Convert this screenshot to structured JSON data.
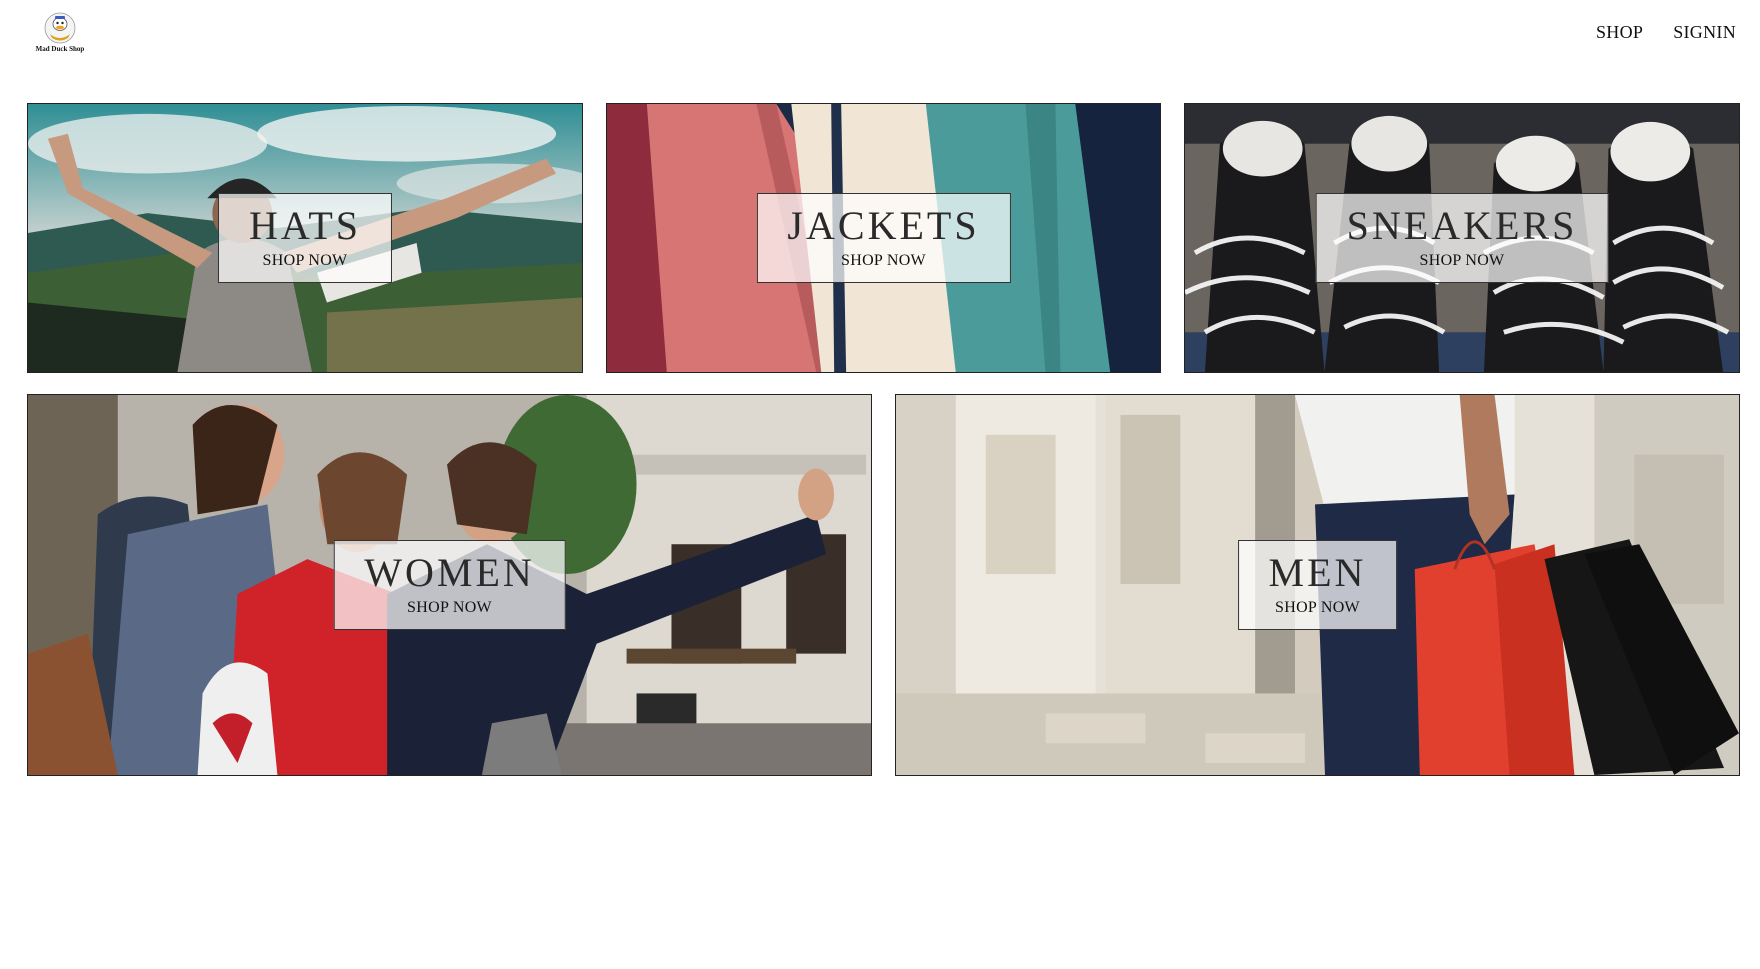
{
  "header": {
    "logo_alt": "Mad Duck Shop",
    "logo_text": "Mad Duck Shop",
    "logo_icon": "duck-logo-icon",
    "nav": [
      {
        "label": "SHOP"
      },
      {
        "label": "SIGNIN"
      }
    ]
  },
  "categories": [
    {
      "title": "HATS",
      "cta": "SHOP NOW"
    },
    {
      "title": "JACKETS",
      "cta": "SHOP NOW"
    },
    {
      "title": "SNEAKERS",
      "cta": "SHOP NOW"
    },
    {
      "title": "WOMEN",
      "cta": "SHOP NOW"
    },
    {
      "title": "MEN",
      "cta": "SHOP NOW"
    }
  ],
  "colors": {
    "text": "#111111",
    "border": "#222222",
    "label_bg": "rgba(255,255,255,0.72)"
  }
}
